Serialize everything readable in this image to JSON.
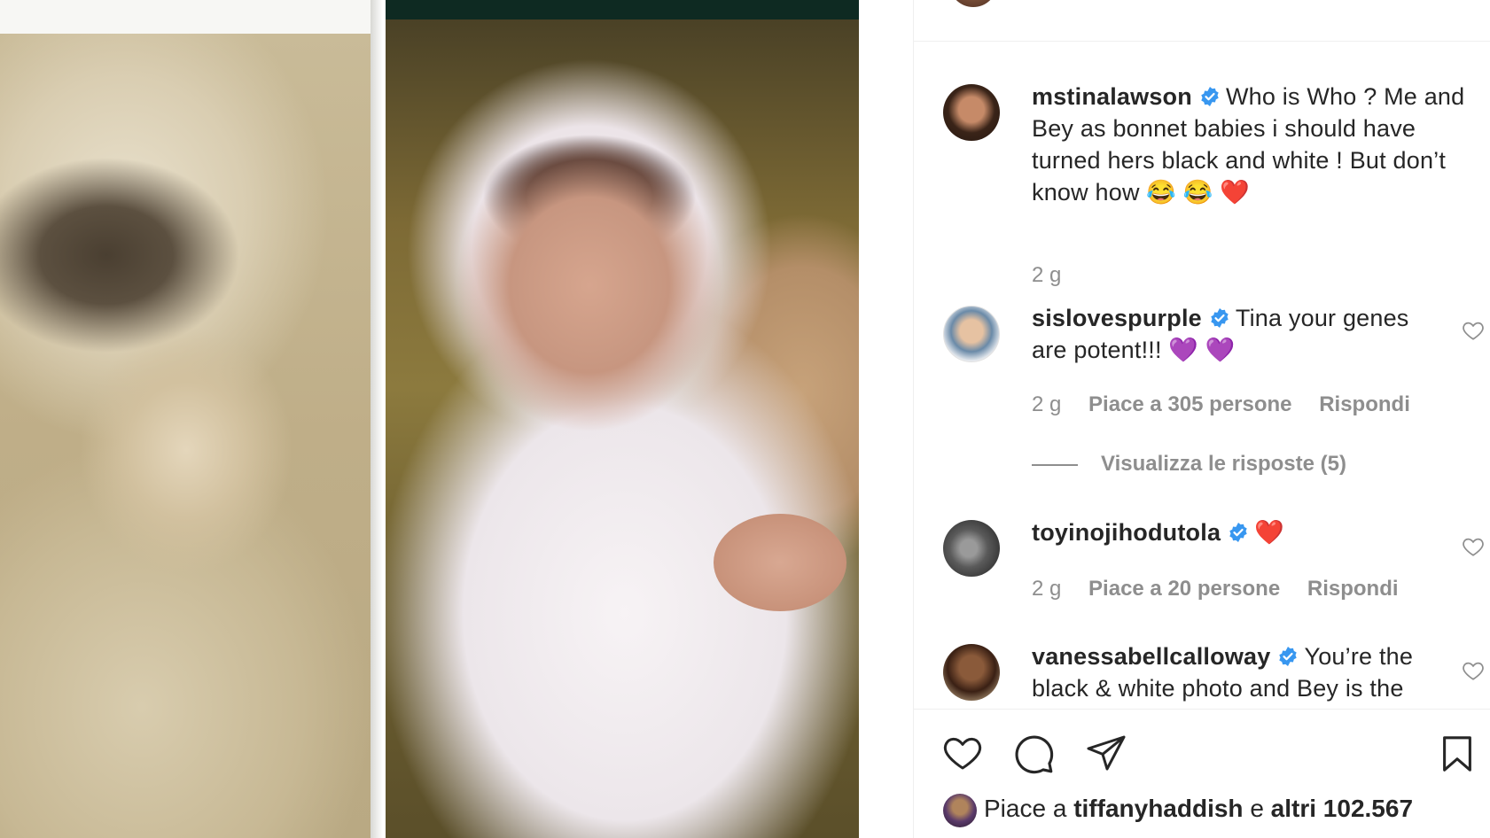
{
  "photos": {
    "left_description": "",
    "right_description": ""
  },
  "comments": [
    {
      "username": "mstinalawson",
      "verified": true,
      "text": "Who is Who ? Me and Bey as bonnet babies i should have turned hers black and white ! But don’t know how 😂 😂 ❤️",
      "time": "2 g"
    },
    {
      "username": "sislovespurple",
      "verified": true,
      "text": "Tina your genes are potent!!! 💜 💜",
      "time": "2 g",
      "likes": "Piace a 305 persone",
      "reply": "Rispondi",
      "view_replies": "Visualizza le risposte (5)"
    },
    {
      "username": "toyinojihodutola",
      "verified": true,
      "text": "❤️",
      "time": "2 g",
      "likes": "Piace a 20 persone",
      "reply": "Rispondi"
    },
    {
      "username": "vanessabellcalloway",
      "verified": true,
      "text": "You’re the black & white photo and Bey is the",
      "time": ""
    }
  ],
  "actions": {
    "like_icon": "heart-outline",
    "comment_icon": "speech-bubble",
    "share_icon": "paper-plane",
    "save_icon": "bookmark"
  },
  "likes_line": {
    "prefix": "Piace a",
    "user": "tiffanyhaddish",
    "connector": "e",
    "others": "altri 102.567"
  },
  "colors": {
    "text": "#262626",
    "muted": "#8e8e8e",
    "verified": "#3897f0",
    "divider": "#efefef"
  }
}
